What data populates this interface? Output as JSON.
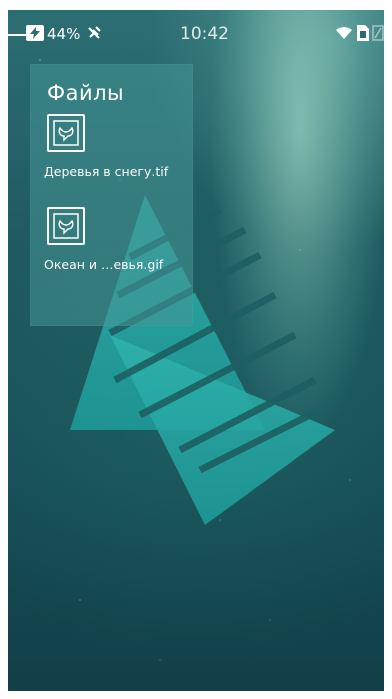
{
  "status_bar": {
    "battery_percent": "44%",
    "time": "10:42",
    "icons": [
      "charging-icon",
      "no-signal-icon",
      "wifi-icon",
      "sim-icon",
      "battery-icon"
    ]
  },
  "files_panel": {
    "title": "Файлы",
    "items": [
      {
        "label": "Деревья в снегу.tif",
        "icon": "image-file-icon"
      },
      {
        "label": "Океан и …евья.gif",
        "icon": "image-file-icon"
      }
    ]
  },
  "colors": {
    "background": "#1f5a60",
    "panel": "#4a9696",
    "logo": "#2aa5a0",
    "text": "#ffffff"
  }
}
